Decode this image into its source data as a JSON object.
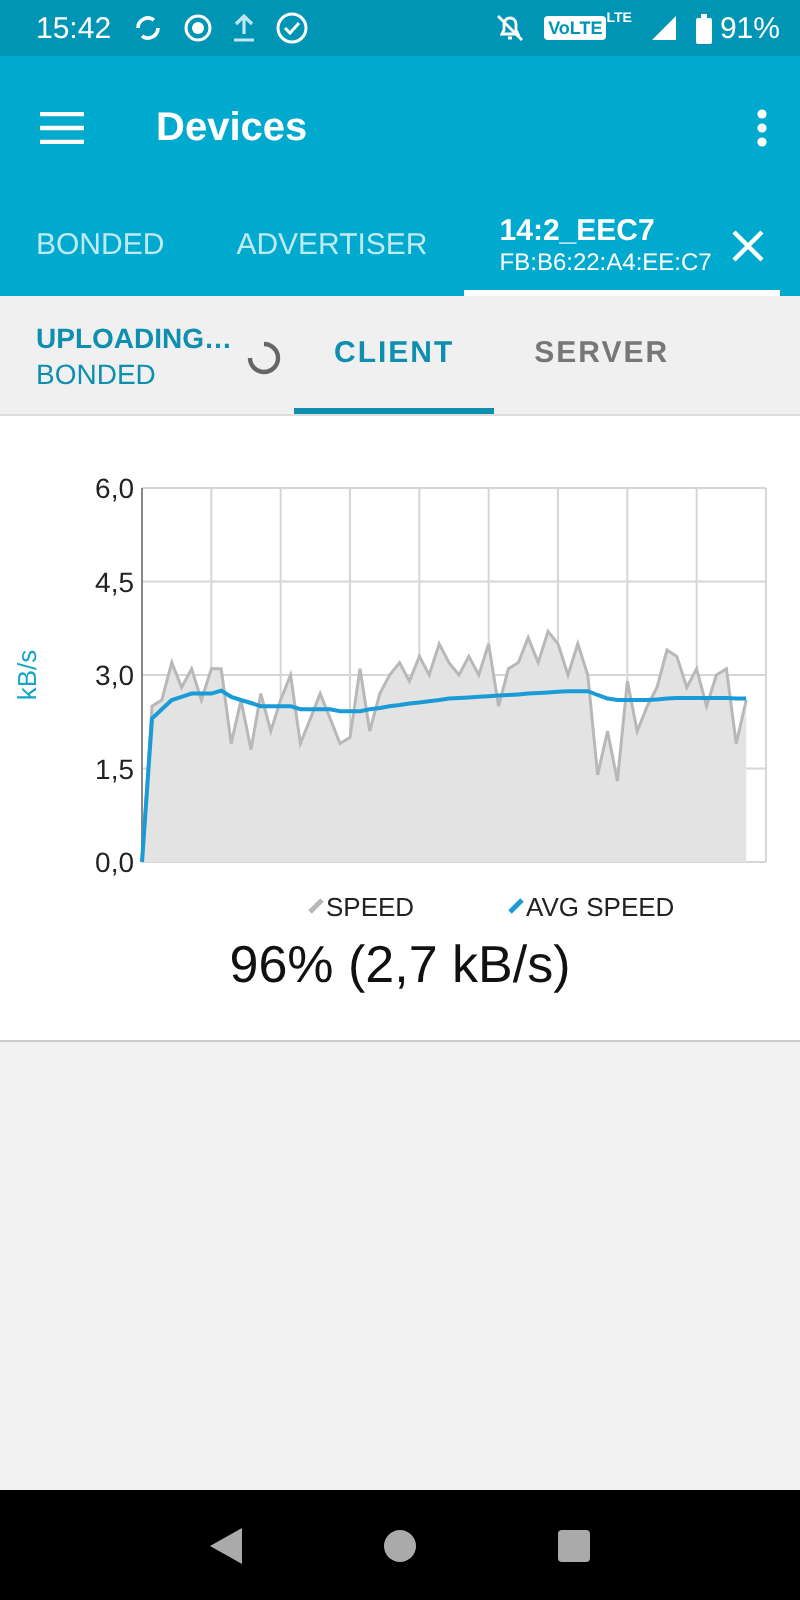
{
  "status_bar": {
    "time": "15:42",
    "network": "VoLTE",
    "network_type": "LTE",
    "battery": "91%"
  },
  "app_bar": {
    "title": "Devices"
  },
  "tabs": [
    {
      "kind": "plain",
      "label": "BONDED",
      "selected": false
    },
    {
      "kind": "plain",
      "label": "ADVERTISER",
      "selected": false
    },
    {
      "kind": "device",
      "label": "14:2_EEC7",
      "address": "FB:B6:22:A4:EE:C7",
      "selected": true
    }
  ],
  "connection": {
    "state": "UPLOADING…",
    "bond": "BONDED",
    "busy": true
  },
  "sub_tabs": [
    {
      "label": "CLIENT",
      "selected": true
    },
    {
      "label": "SERVER",
      "selected": false
    }
  ],
  "chart": {
    "chart_data": {
      "type": "area",
      "ylabel": "kB/s",
      "grid": true,
      "legend": "bottom",
      "categories": [
        null,
        null,
        null,
        null,
        null,
        null,
        null,
        null,
        null,
        null,
        null,
        null,
        null,
        null,
        null,
        null,
        null,
        null,
        null,
        null,
        null,
        null,
        null,
        null,
        null,
        null,
        null,
        null,
        null,
        null,
        null,
        null,
        null,
        null,
        null,
        null,
        null,
        null,
        null,
        null,
        null,
        null,
        null,
        null,
        null,
        null,
        null,
        null,
        null,
        null,
        null,
        null,
        null,
        null,
        null,
        null,
        null,
        null,
        null,
        null,
        null,
        null
      ],
      "ylim": [
        0,
        6
      ],
      "yticks": [
        {
          "value": 0,
          "label": "0,0"
        },
        {
          "value": 1.5,
          "label": "1,5"
        },
        {
          "value": 3,
          "label": "3,0"
        },
        {
          "value": 4.5,
          "label": "4,5"
        },
        {
          "value": 6,
          "label": "6,0"
        }
      ],
      "series": [
        {
          "name": "SPEED",
          "type": "area",
          "color": "#b8b8b8",
          "values": [
            0,
            2.5,
            2.6,
            3.2,
            2.8,
            3.1,
            2.6,
            3.1,
            3.1,
            1.9,
            2.6,
            1.8,
            2.7,
            2.1,
            2.6,
            3.0,
            1.9,
            2.3,
            2.7,
            2.3,
            1.9,
            2.0,
            3.1,
            2.1,
            2.7,
            3.0,
            3.2,
            2.9,
            3.3,
            3.0,
            3.5,
            3.2,
            3.0,
            3.3,
            3.0,
            3.5,
            2.5,
            3.1,
            3.2,
            3.6,
            3.2,
            3.7,
            3.5,
            3.0,
            3.5,
            3.0,
            1.4,
            2.1,
            1.3,
            2.9,
            2.1,
            2.5,
            2.8,
            3.4,
            3.3,
            2.8,
            3.1,
            2.5,
            3.0,
            3.1,
            1.9,
            2.6
          ]
        },
        {
          "name": "AVG SPEED",
          "type": "line",
          "color": "#1a9bd7",
          "values": [
            0,
            2.3,
            2.45,
            2.6,
            2.65,
            2.7,
            2.7,
            2.7,
            2.75,
            2.65,
            2.6,
            2.55,
            2.5,
            2.5,
            2.5,
            2.5,
            2.45,
            2.45,
            2.45,
            2.45,
            2.42,
            2.42,
            2.42,
            2.45,
            2.47,
            2.5,
            2.52,
            2.54,
            2.56,
            2.58,
            2.6,
            2.62,
            2.63,
            2.64,
            2.65,
            2.66,
            2.67,
            2.68,
            2.69,
            2.7,
            2.71,
            2.72,
            2.73,
            2.74,
            2.74,
            2.74,
            2.68,
            2.62,
            2.6,
            2.6,
            2.6,
            2.6,
            2.61,
            2.62,
            2.63,
            2.63,
            2.63,
            2.63,
            2.63,
            2.63,
            2.62,
            2.62
          ]
        }
      ]
    },
    "progress": "96% (2,7 kB/s)"
  }
}
